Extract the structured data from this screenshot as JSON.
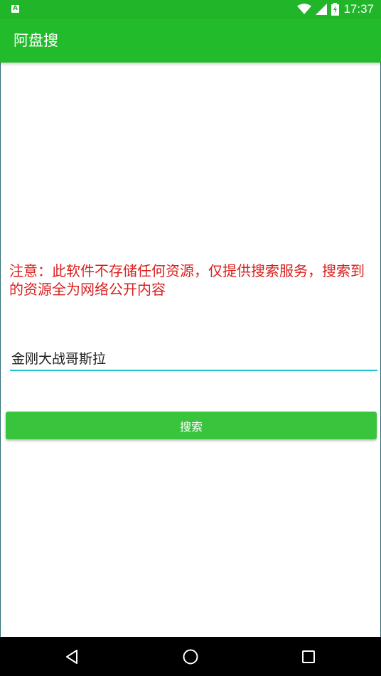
{
  "status_bar": {
    "notification_icon": "A",
    "time": "17:37",
    "icons": [
      "wifi-icon",
      "signal-icon",
      "battery-charging-icon"
    ]
  },
  "app_bar": {
    "title": "阿盘搜"
  },
  "main": {
    "notice_text": "注意：此软件不存储任何资源，仅提供搜索服务，搜索到的资源全为网络公开内容",
    "search_input_value": "金刚大战哥斯拉",
    "search_button_label": "搜索"
  },
  "nav_bar": {
    "buttons": [
      "back-icon",
      "home-icon",
      "recents-icon"
    ]
  },
  "colors": {
    "status_bar": "#21b52a",
    "app_bar": "#22bb2c",
    "notice_text": "#d9201e",
    "input_underline": "#20c7cf",
    "button": "#39c43e"
  }
}
